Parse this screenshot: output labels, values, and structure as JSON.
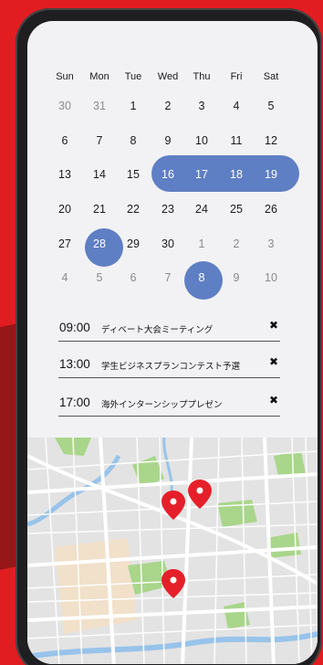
{
  "calendar": {
    "weekdays": [
      "Sun",
      "Mon",
      "Tue",
      "Wed",
      "Thu",
      "Fri",
      "Sat"
    ],
    "weeks": [
      [
        "30",
        "31",
        "1",
        "2",
        "3",
        "4",
        "5"
      ],
      [
        "6",
        "7",
        "8",
        "9",
        "10",
        "11",
        "12"
      ],
      [
        "13",
        "14",
        "15",
        "16",
        "17",
        "18",
        "19"
      ],
      [
        "20",
        "21",
        "22",
        "23",
        "24",
        "25",
        "26"
      ],
      [
        "27",
        "28",
        "29",
        "30",
        "1",
        "2",
        "3"
      ],
      [
        "4",
        "5",
        "6",
        "7",
        "8",
        "9",
        "10"
      ]
    ],
    "muted_days": [
      [
        0,
        0
      ],
      [
        0,
        1
      ],
      [
        4,
        4
      ],
      [
        4,
        5
      ],
      [
        4,
        6
      ],
      [
        5,
        0
      ],
      [
        5,
        1
      ],
      [
        5,
        2
      ],
      [
        5,
        3
      ],
      [
        5,
        5
      ],
      [
        5,
        6
      ]
    ],
    "selected_range": {
      "week": 2,
      "from_col": 3,
      "to_col": 6
    },
    "selected_days": [
      [
        4,
        1
      ],
      [
        5,
        4
      ]
    ],
    "accent_color": "#5f7fc4"
  },
  "events": [
    {
      "time": "09:00",
      "title": "ディベート大会ミーティング",
      "close_label": "✖"
    },
    {
      "time": "13:00",
      "title": "学生ビジネスプランコンテスト予選",
      "close_label": "✖"
    },
    {
      "time": "17:00",
      "title": "海外インターンシッププレゼン",
      "close_label": "✖"
    }
  ],
  "map": {
    "pin_icon": "map-pin-icon",
    "pin_color": "#e5202a",
    "pin_count": 3
  }
}
